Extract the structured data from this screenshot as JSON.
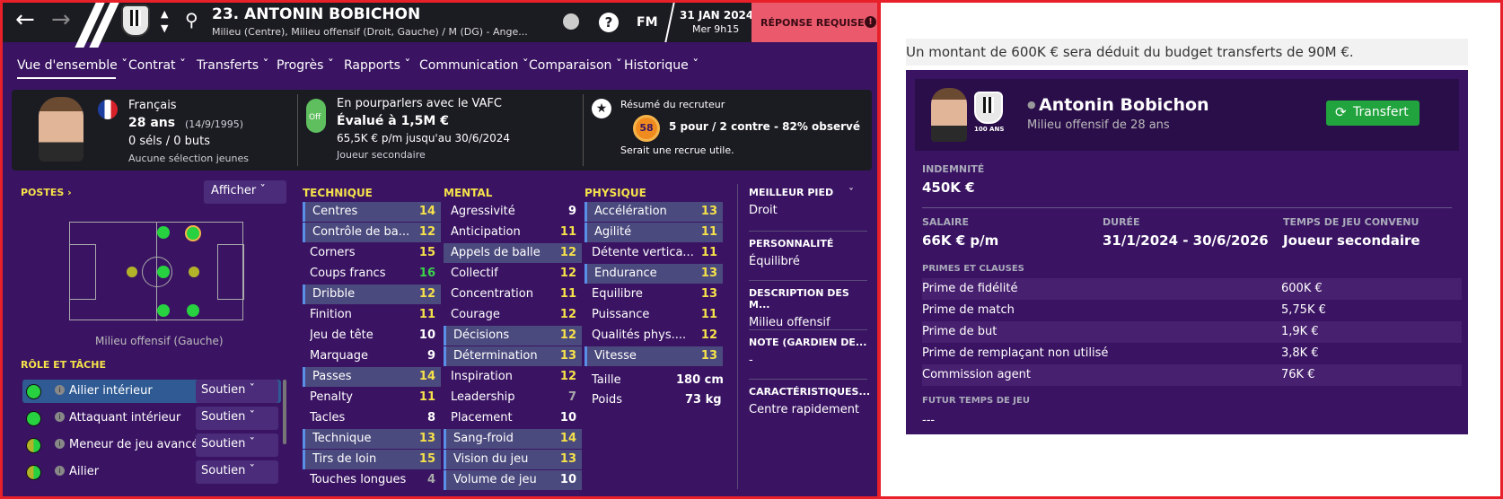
{
  "header": {
    "title": "23. ANTONIN BOBICHON",
    "subtitle": "Milieu (Centre), Milieu offensif (Droit, Gauche) / M (DG) - Ange...",
    "crest_text": "100 ANS",
    "date": "31 JAN 2024",
    "time": "Mer 9h15",
    "fm": "FM",
    "reply": "RÉPONSE REQUISE"
  },
  "nav": [
    "Vue d'ensemble",
    "Contrat",
    "Transferts",
    "Progrès",
    "Rapports",
    "Communication",
    "Comparaison",
    "Historique"
  ],
  "info": {
    "nationality": "Français",
    "age": "28 ans",
    "dob": "(14/9/1995)",
    "caps": "0 séls / 0 buts",
    "youth": "Aucune sélection jeunes",
    "status": "En pourparlers avec le VAFC",
    "value": "Évalué à 1,5M €",
    "wage": "65,5K € p/m jusqu'au 30/6/2024",
    "role": "Joueur secondaire",
    "toggle": "Off",
    "scout_title": "Résumé du recruteur",
    "scout_score": "58",
    "scout_line": "5 pour / 2 contre - 82% observé",
    "scout_sub": "Serait une recrue utile."
  },
  "positions": {
    "title": "POSTES",
    "show": "Afficher",
    "caption": "Milieu offensif (Gauche)"
  },
  "roles": {
    "title": "RÔLE ET TÂCHE",
    "items": [
      {
        "name": "Ailier intérieur",
        "duty": "Soutien"
      },
      {
        "name": "Attaquant intérieur",
        "duty": "Soutien"
      },
      {
        "name": "Meneur de jeu avancé",
        "duty": "Soutien"
      },
      {
        "name": "Ailier",
        "duty": "Soutien"
      }
    ]
  },
  "technique": {
    "title": "TECHNIQUE",
    "rows": [
      [
        "Centres",
        "14"
      ],
      [
        "Contrôle de ba...",
        "12"
      ],
      [
        "Corners",
        "15"
      ],
      [
        "Coups francs",
        "16"
      ],
      [
        "Dribble",
        "12"
      ],
      [
        "Finition",
        "11"
      ],
      [
        "Jeu de tête",
        "10"
      ],
      [
        "Marquage",
        "9"
      ],
      [
        "Passes",
        "14"
      ],
      [
        "Penalty",
        "11"
      ],
      [
        "Tacles",
        "8"
      ],
      [
        "Technique",
        "13"
      ],
      [
        "Tirs de loin",
        "15"
      ],
      [
        "Touches longues",
        "4"
      ]
    ]
  },
  "mental": {
    "title": "MENTAL",
    "rows": [
      [
        "Agressivité",
        "9"
      ],
      [
        "Anticipation",
        "11"
      ],
      [
        "Appels de balle",
        "12"
      ],
      [
        "Collectif",
        "12"
      ],
      [
        "Concentration",
        "11"
      ],
      [
        "Courage",
        "12"
      ],
      [
        "Décisions",
        "12"
      ],
      [
        "Détermination",
        "13"
      ],
      [
        "Inspiration",
        "12"
      ],
      [
        "Leadership",
        "7"
      ],
      [
        "Placement",
        "10"
      ],
      [
        "Sang-froid",
        "14"
      ],
      [
        "Vision du jeu",
        "13"
      ],
      [
        "Volume de jeu",
        "10"
      ]
    ]
  },
  "physique": {
    "title": "PHYSIQUE",
    "rows": [
      [
        "Accélération",
        "13"
      ],
      [
        "Agilité",
        "11"
      ],
      [
        "Détente vertica...",
        "11"
      ],
      [
        "Endurance",
        "13"
      ],
      [
        "Équilibre",
        "13"
      ],
      [
        "Puissance",
        "11"
      ],
      [
        "Qualités phys....",
        "12"
      ],
      [
        "Vitesse",
        "13"
      ]
    ],
    "height_label": "Taille",
    "height": "180 cm",
    "weight_label": "Poids",
    "weight": "73 kg"
  },
  "side": [
    {
      "h": "MEILLEUR PIED",
      "v": "Droit"
    },
    {
      "h": "PERSONNALITÉ",
      "v": "Équilibré"
    },
    {
      "h": "DESCRIPTION DES M...",
      "v": "Milieu offensif"
    },
    {
      "h": "NOTE (GARDIEN DE...",
      "v": "-"
    },
    {
      "h": "CARACTÉRISTIQUES...",
      "v": "Centre rapidement"
    }
  ],
  "right": {
    "notice": "Un montant de 600K € sera déduit du budget transferts de 90M €.",
    "name": "Antonin Bobichon",
    "desc": "Milieu offensif de 28 ans",
    "button": "Transfert",
    "indem_label": "INDEMNITÉ",
    "indem": "450K €",
    "salary_label": "SALAIRE",
    "salary": "66K € p/m",
    "duration_label": "DURÉE",
    "duration": "31/1/2024 - 30/6/2026",
    "playtime_label": "TEMPS DE JEU CONVENU",
    "playtime": "Joueur secondaire",
    "primes_label": "PRIMES ET CLAUSES",
    "primes": [
      [
        "Prime de fidélité",
        "600K €"
      ],
      [
        "Prime de match",
        "5,75K €"
      ],
      [
        "Prime de but",
        "1,9K €"
      ],
      [
        "Prime de remplaçant non utilisé",
        "3,8K €"
      ],
      [
        "Commission agent",
        "76K €"
      ]
    ],
    "future_label": "FUTUR TEMPS DE JEU",
    "future": "---"
  }
}
